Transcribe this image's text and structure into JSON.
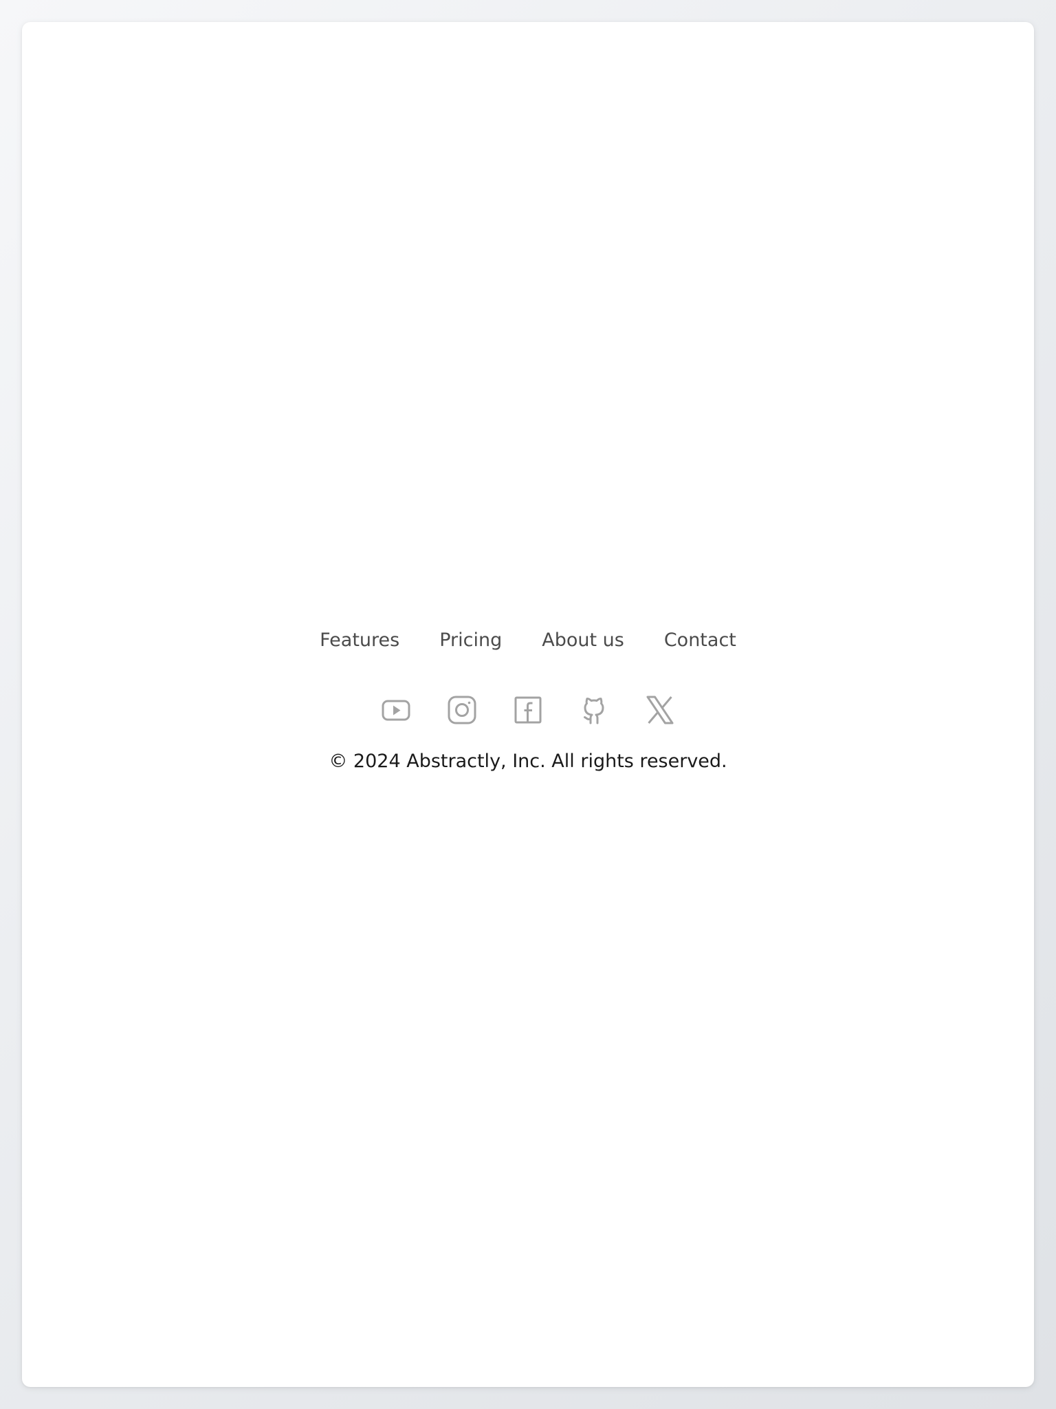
{
  "footer": {
    "nav": [
      {
        "label": "Features"
      },
      {
        "label": "Pricing"
      },
      {
        "label": "About us"
      },
      {
        "label": "Contact"
      }
    ],
    "social_icons": [
      "youtube-icon",
      "instagram-icon",
      "facebook-icon",
      "github-icon",
      "x-icon"
    ],
    "copyright": "© 2024 Abstractly, Inc. All rights reserved.",
    "colors": {
      "link": "#4b4b4b",
      "icon": "#a3a3a3",
      "text": "#1a1a1a",
      "card": "#ffffff"
    }
  }
}
